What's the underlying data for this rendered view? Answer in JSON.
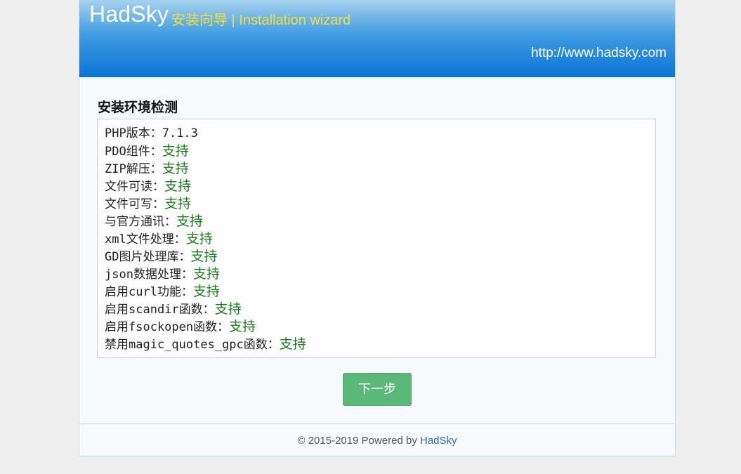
{
  "header": {
    "logo": "HadSky",
    "subtitle": "安装向导 | Installation wizard",
    "site_url": "http://www.hadsky.com"
  },
  "section_title": "安装环境检测",
  "checks": [
    {
      "label": "PHP版本：",
      "value": "7.1.3",
      "status": "plain"
    },
    {
      "label": "PDO组件：",
      "value": "支持",
      "status": "ok"
    },
    {
      "label": "ZIP解压：",
      "value": "支持",
      "status": "ok"
    },
    {
      "label": "文件可读：",
      "value": "支持",
      "status": "ok"
    },
    {
      "label": "文件可写：",
      "value": "支持",
      "status": "ok"
    },
    {
      "label": "与官方通讯：",
      "value": "支持",
      "status": "ok"
    },
    {
      "label": "xml文件处理：",
      "value": "支持",
      "status": "ok"
    },
    {
      "label": "GD图片处理库：",
      "value": "支持",
      "status": "ok"
    },
    {
      "label": "json数据处理：",
      "value": "支持",
      "status": "ok"
    },
    {
      "label": "启用curl功能：",
      "value": "支持",
      "status": "ok"
    },
    {
      "label": "启用scandir函数：",
      "value": "支持",
      "status": "ok"
    },
    {
      "label": "启用fsockopen函数：",
      "value": "支持",
      "status": "ok"
    },
    {
      "label": "禁用magic_quotes_gpc函数：",
      "value": "支持",
      "status": "ok"
    }
  ],
  "next_button": "下一步",
  "footer": {
    "copyright": "© 2015-2019 Powered by ",
    "link_text": "HadSky"
  },
  "colors": {
    "ok": "#1c7d1c",
    "button": "#5cb878",
    "header_top": "#a8d2ef",
    "header_bottom": "#0b74d7",
    "subtitle": "#f3df3a"
  }
}
